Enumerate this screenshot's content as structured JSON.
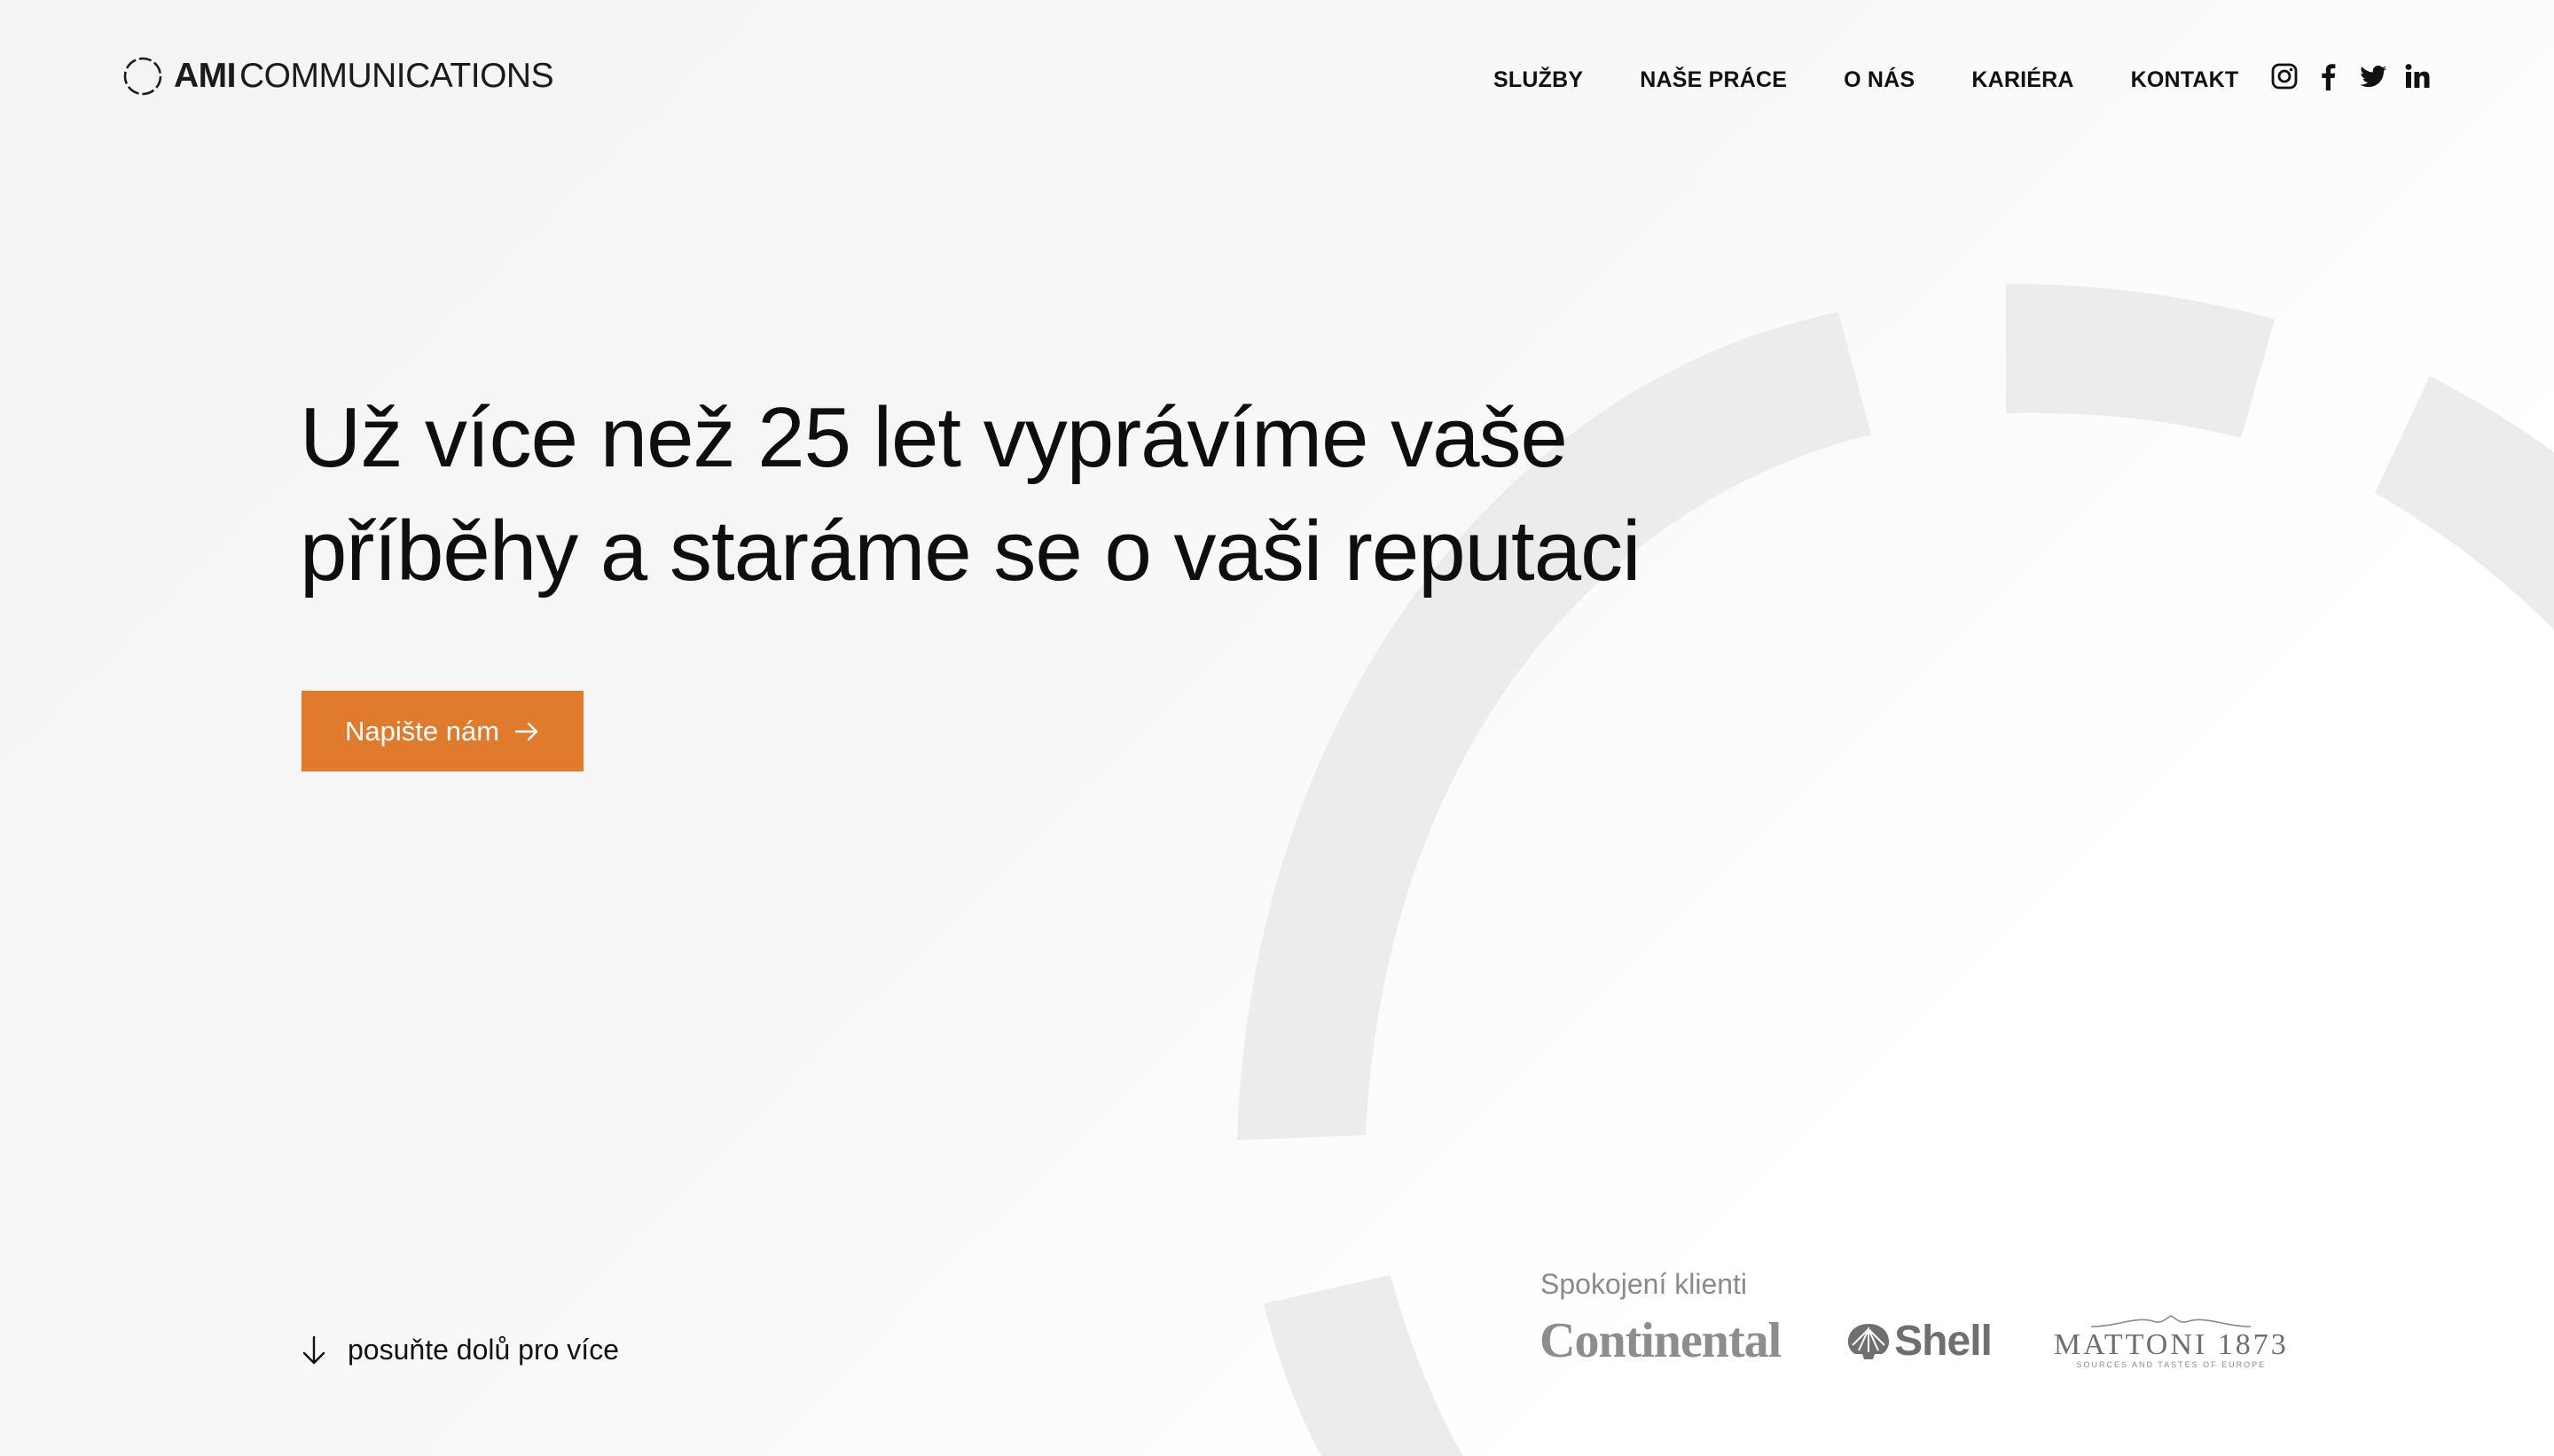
{
  "header": {
    "logo": {
      "bold": "AMI",
      "light": "COMMUNICATIONS"
    },
    "nav": [
      "SLUŽBY",
      "NAŠE PRÁCE",
      "O NÁS",
      "KARIÉRA",
      "KONTAKT"
    ],
    "social": [
      "instagram-icon",
      "facebook-icon",
      "twitter-icon",
      "linkedin-icon"
    ]
  },
  "hero": {
    "title_line1": "Už více než 25 let vyprávíme vaše",
    "title_line2": "příběhy a staráme se o vaši reputaci",
    "cta_label": "Napište nám",
    "scroll_label": "posuňte dolů pro více"
  },
  "clients": {
    "label": "Spokojení klienti",
    "logos": [
      "Continental",
      "Shell",
      "MATTONI 1873"
    ],
    "mattoni_tag": "SOURCES AND TASTES OF EUROPE"
  },
  "colors": {
    "accent": "#e07a2c",
    "text": "#111111",
    "muted": "#8a8a8a",
    "ring": "#ebebeb"
  }
}
